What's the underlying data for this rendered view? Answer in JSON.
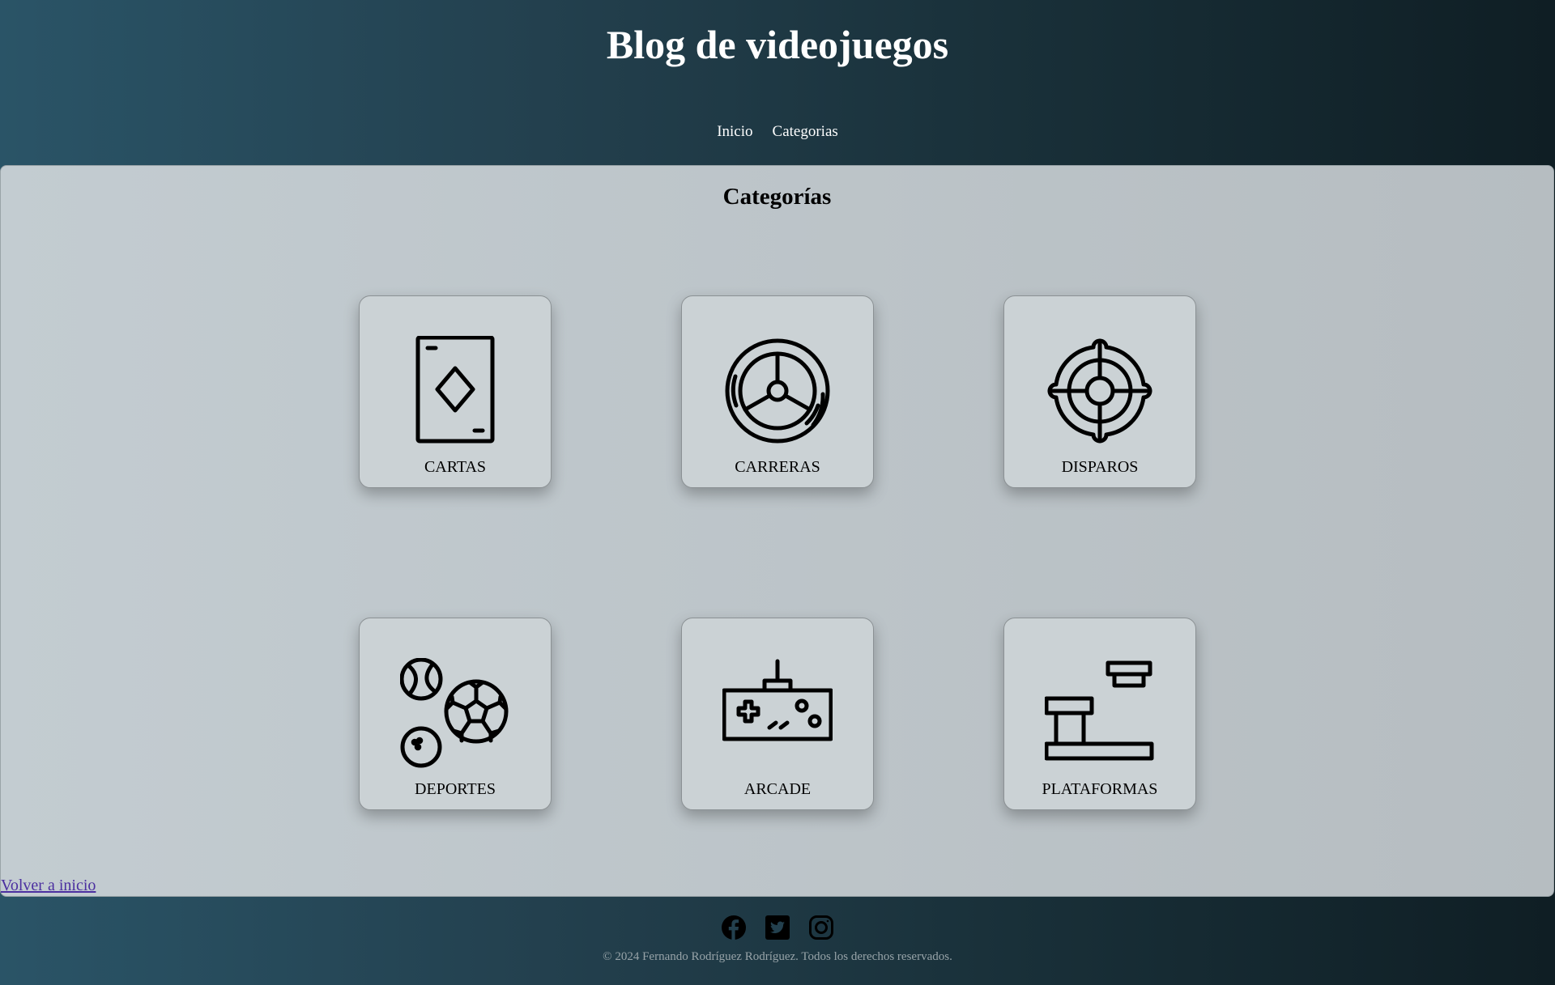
{
  "site": {
    "title": "Blog de videojuegos"
  },
  "nav": {
    "items": [
      {
        "label": "Inicio"
      },
      {
        "label": "Categorias"
      }
    ]
  },
  "main": {
    "title": "Categorías",
    "categories": [
      {
        "label": "CARTAS",
        "icon": "playing-card-icon"
      },
      {
        "label": "CARRERAS",
        "icon": "steering-wheel-icon"
      },
      {
        "label": "DISPAROS",
        "icon": "crosshair-icon"
      },
      {
        "label": "DEPORTES",
        "icon": "sports-balls-icon"
      },
      {
        "label": "ARCADE",
        "icon": "gamepad-icon"
      },
      {
        "label": "PLATAFORMAS",
        "icon": "platforms-icon"
      }
    ],
    "back_link": "Volver a inicio"
  },
  "footer": {
    "social": [
      {
        "icon": "facebook-icon"
      },
      {
        "icon": "twitter-icon"
      },
      {
        "icon": "instagram-icon"
      }
    ],
    "copyright": "© 2024 Fernando Rodríguez Rodríguez. Todos los derechos reservados."
  },
  "colors": {
    "accent_text": "#ffffff",
    "link": "#4b2fa0"
  }
}
